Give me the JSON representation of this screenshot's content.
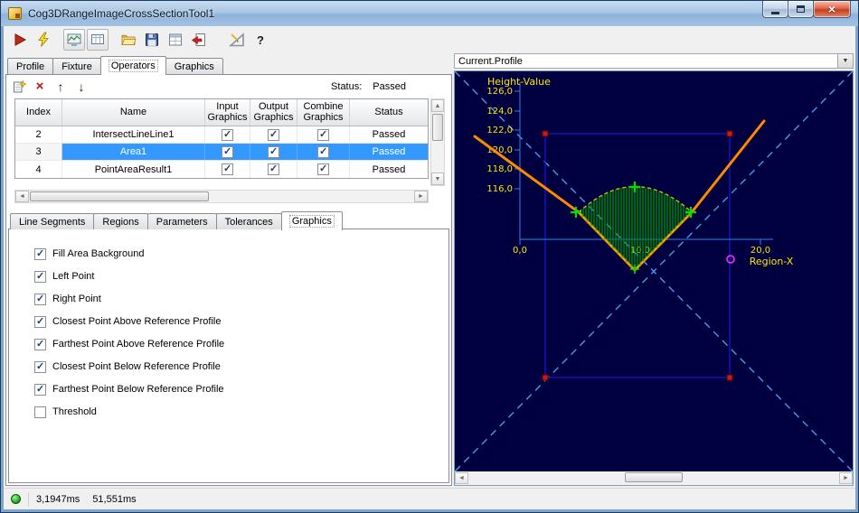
{
  "window": {
    "title": "Cog3DRangeImageCrossSectionTool1"
  },
  "toolbar": {
    "buttons": [
      "run",
      "run-continuous",
      "display-toggle-a",
      "display-toggle-b",
      "open-file",
      "save-file",
      "copy-grid",
      "import-image",
      "measure",
      "help"
    ]
  },
  "main_tabs": [
    {
      "label": "Profile",
      "active": false
    },
    {
      "label": "Fixture",
      "active": false
    },
    {
      "label": "Operators",
      "active": true
    },
    {
      "label": "Graphics",
      "active": false
    }
  ],
  "operators": {
    "status_label": "Status:",
    "status_value": "Passed",
    "table": {
      "headers": [
        "Index",
        "Name",
        "Input Graphics",
        "Output Graphics",
        "Combine Graphics",
        "Status"
      ],
      "rows": [
        {
          "index": "2",
          "name": "IntersectLineLine1",
          "input": true,
          "output": true,
          "combine": true,
          "status": "Passed",
          "selected": false
        },
        {
          "index": "3",
          "name": "Area1",
          "input": true,
          "output": true,
          "combine": true,
          "status": "Passed",
          "selected": true
        },
        {
          "index": "4",
          "name": "PointAreaResult1",
          "input": true,
          "output": true,
          "combine": true,
          "status": "Passed",
          "selected": false
        }
      ]
    }
  },
  "sub_tabs": [
    {
      "label": "Line Segments",
      "active": false
    },
    {
      "label": "Regions",
      "active": false
    },
    {
      "label": "Parameters",
      "active": false
    },
    {
      "label": "Tolerances",
      "active": false
    },
    {
      "label": "Graphics",
      "active": true
    }
  ],
  "graphics_options": [
    {
      "label": "Fill Area Background",
      "checked": true
    },
    {
      "label": "Left Point",
      "checked": true
    },
    {
      "label": "Right Point",
      "checked": true
    },
    {
      "label": "Closest Point Above Reference Profile",
      "checked": true
    },
    {
      "label": "Farthest Point Above Reference Profile",
      "checked": true
    },
    {
      "label": "Closest Point Below Reference Profile",
      "checked": true
    },
    {
      "label": "Farthest Point Below Reference Profile",
      "checked": true
    },
    {
      "label": "Threshold",
      "checked": false
    }
  ],
  "profile": {
    "selector_value": "Current.Profile",
    "plot": {
      "y_title": "Height-Value",
      "x_title": "Region-X",
      "y_ticks": [
        "126,0",
        "124,0",
        "122,0",
        "120,0",
        "118,0",
        "116,0"
      ],
      "x_ticks": [
        "0,0",
        "10,0",
        "20,0"
      ],
      "y_range": [
        116,
        126
      ],
      "x_range": [
        0,
        20
      ]
    }
  },
  "status_bar": {
    "process_time": "3,1947ms",
    "total_time": "51,551ms"
  }
}
